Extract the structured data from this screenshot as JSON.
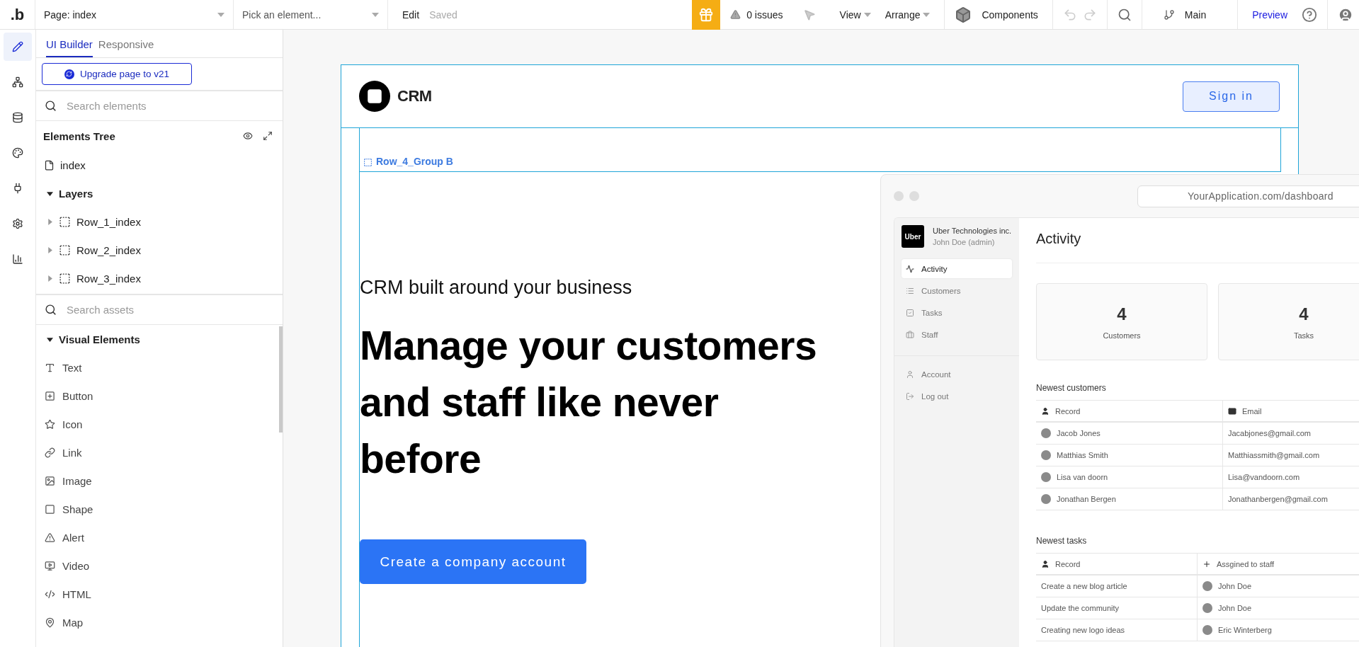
{
  "top_bar": {
    "logo": ".b",
    "page_selector": "Page: index",
    "element_picker": {
      "placeholder": "Pick an element..."
    },
    "edit": "Edit",
    "save_status": "Saved",
    "issues": "0 issues",
    "menus": [
      {
        "label": "View"
      },
      {
        "label": "Arrange"
      }
    ],
    "components": "Components",
    "branch": "Main",
    "preview": "Preview"
  },
  "rail": [
    {
      "kind": "design",
      "selected": true
    },
    {
      "kind": "workflow",
      "selected": false
    },
    {
      "kind": "data",
      "selected": false
    },
    {
      "kind": "styles",
      "selected": false
    },
    {
      "kind": "plugins",
      "selected": false
    },
    {
      "kind": "settings",
      "selected": false
    },
    {
      "kind": "logs",
      "selected": false
    }
  ],
  "panel": {
    "tabs": [
      {
        "label": "UI Builder",
        "selected": true
      },
      {
        "label": "Responsive",
        "selected": false
      }
    ],
    "upgrade_button": "Upgrade page to v21",
    "element_search": {
      "placeholder": "Search elements"
    },
    "tree": {
      "title": "Elements Tree",
      "page": "index",
      "layers": {
        "label": "Layers",
        "expanded": true,
        "children": [
          {
            "label": "Row_1_index",
            "expanded": false
          },
          {
            "label": "Row_2_index",
            "expanded": false
          },
          {
            "label": "Row_3_index",
            "expanded": false
          }
        ]
      }
    },
    "asset_search": {
      "placeholder": "Search assets"
    },
    "assets": {
      "label": "Visual Elements",
      "expanded": true,
      "items": [
        {
          "label": "Text",
          "kind": "text"
        },
        {
          "label": "Button",
          "kind": "button"
        },
        {
          "label": "Icon",
          "kind": "icon"
        },
        {
          "label": "Link",
          "kind": "link"
        },
        {
          "label": "Image",
          "kind": "image"
        },
        {
          "label": "Shape",
          "kind": "shape"
        },
        {
          "label": "Alert",
          "kind": "alert"
        },
        {
          "label": "Video",
          "kind": "video"
        },
        {
          "label": "HTML",
          "kind": "html"
        },
        {
          "label": "Map",
          "kind": "map"
        }
      ]
    }
  },
  "canvas": {
    "logo": "CRM",
    "sign_in": "Sign in",
    "group_label": "Row_4_Group B",
    "hero": {
      "eyebrow": "CRM built around your business",
      "headline": "Manage your customers and staff like never before",
      "cta": "Create a company account"
    },
    "dashboard": {
      "url": "YourApplication.com/dashboard",
      "brand": "Uber",
      "company": "Uber Technologies inc.",
      "user": "John Doe (admin)",
      "nav": [
        {
          "label": "Activity",
          "kind": "activity",
          "selected": true
        },
        {
          "label": "Customers",
          "kind": "list",
          "selected": false
        },
        {
          "label": "Tasks",
          "kind": "tasks",
          "selected": false
        },
        {
          "label": "Staff",
          "kind": "staff",
          "selected": false
        }
      ],
      "account_nav": [
        {
          "label": "Account",
          "kind": "account"
        },
        {
          "label": "Log out",
          "kind": "logout"
        }
      ],
      "title": "Activity",
      "stats": [
        {
          "value": "4",
          "label": "Customers"
        },
        {
          "value": "4",
          "label": "Tasks"
        }
      ],
      "customers": {
        "title": "Newest customers",
        "columns": [
          {
            "label": "Record",
            "kind": "person"
          },
          {
            "label": "Email",
            "kind": "mail"
          }
        ],
        "rows": [
          {
            "name": "Jacob Jones",
            "email": "Jacabjones@gmail.com"
          },
          {
            "name": "Matthias Smith",
            "email": "Matthiassmith@gmail.com"
          },
          {
            "name": "Lisa van doorn",
            "email": "Lisa@vandoorn.com"
          },
          {
            "name": "Jonathan Bergen",
            "email": "Jonathanbergen@gmail.com"
          }
        ]
      },
      "tasks": {
        "title": "Newest tasks",
        "columns": [
          {
            "label": "Record",
            "kind": "person"
          },
          {
            "label": "Assgined to staff",
            "kind": "plus"
          }
        ],
        "rows": [
          {
            "task": "Create a new blog article",
            "assignee": "John Doe"
          },
          {
            "task": "Update the community",
            "assignee": "John Doe"
          },
          {
            "task": "Creating new logo ideas",
            "assignee": "Eric Winterberg"
          }
        ]
      }
    }
  }
}
